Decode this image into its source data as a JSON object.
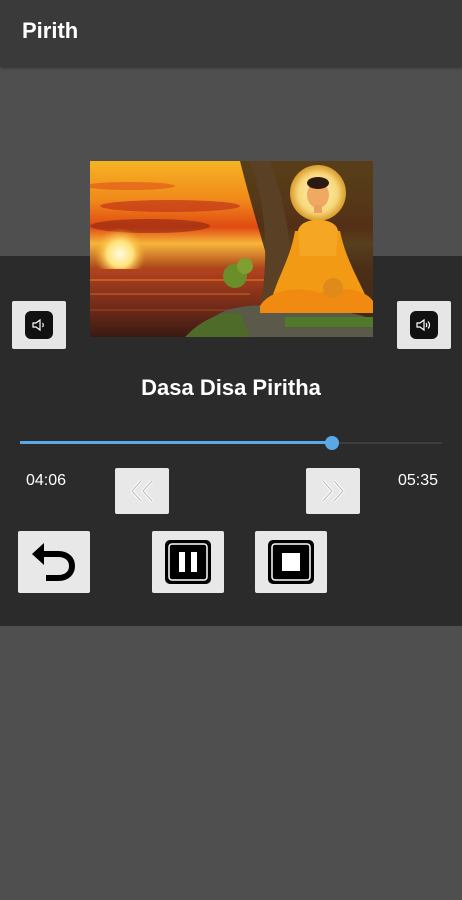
{
  "app_bar": {
    "title": "Pirith"
  },
  "player": {
    "artwork_icon": "buddha-sunset-image",
    "volume_down_icon": "volume-down-icon",
    "volume_up_icon": "volume-up-icon",
    "track_title": "Dasa Disa Piritha",
    "progress_fraction": 0.74,
    "current_time": "04:06",
    "total_time": "05:35",
    "rewind_icon": "rewind-icon",
    "fast_forward_icon": "fast-forward-icon",
    "back_icon": "back-arrow-icon",
    "pause_icon": "pause-icon",
    "stop_icon": "stop-icon"
  },
  "colors": {
    "app_bar": "#3a3a3a",
    "background": "#4f4f4f",
    "panel": "#2b2b2b",
    "accent": "#5aa9e6"
  }
}
